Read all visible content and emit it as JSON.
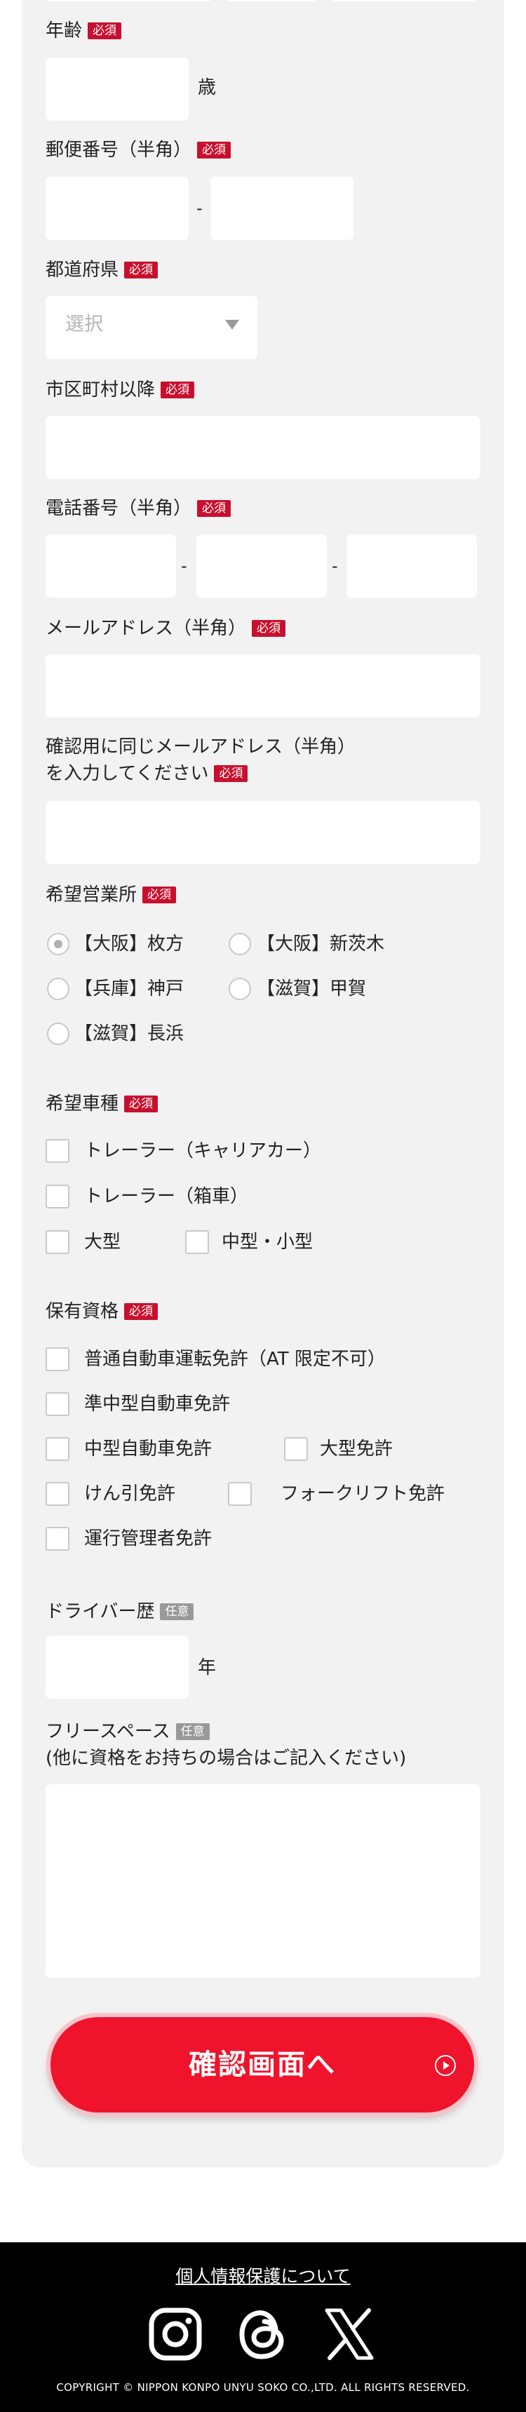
{
  "labels": {
    "required": "必須",
    "optional": "任意",
    "age": "年齢",
    "age_unit": "歳",
    "postal": "郵便番号（半角）",
    "postal_sep": "-",
    "prefecture": "都道府県",
    "prefecture_placeholder": "選択",
    "city": "市区町村以降",
    "phone": "電話番号（半角）",
    "phone_sep": "-",
    "email": "メールアドレス（半角）",
    "email_confirm_1": "確認用に同じメールアドレス（半角）",
    "email_confirm_2": "を入力してください",
    "office": "希望営業所",
    "vehicle": "希望車種",
    "license": "保有資格",
    "driver_years": "ドライバー歴",
    "driver_years_unit": "年",
    "free_space_1": "フリースペース",
    "free_space_2": "(他に資格をお持ちの場合はご記入ください)"
  },
  "office_options": [
    "【大阪】枚方",
    "【大阪】新茨木",
    "【兵庫】神戸",
    "【滋賀】甲賀",
    "【滋賀】長浜"
  ],
  "office_selected": "【大阪】枚方",
  "vehicle_options": [
    "トレーラー（キャリアカー）",
    "トレーラー（箱車）",
    "大型",
    "中型・小型"
  ],
  "license_options": [
    "普通自動車運転免許（AT 限定不可）",
    "準中型自動車免許",
    "中型自動車免許",
    "大型免許",
    "けん引免許",
    "フォークリフト免許",
    "運行管理者免許"
  ],
  "submit_label": "確認画面へ",
  "footer": {
    "privacy_link": "個人情報保護について",
    "social": [
      "instagram-icon",
      "threads-icon",
      "x-icon"
    ],
    "copyright": "COPYRIGHT © NIPPON KONPO UNYU SOKO CO.,LTD. ALL RIGHTS RESERVED."
  },
  "colors": {
    "accent": "#f0132c",
    "required_badge": "#c8102e",
    "optional_badge": "#999999",
    "panel": "#f2f2f2",
    "footer": "#000000"
  }
}
